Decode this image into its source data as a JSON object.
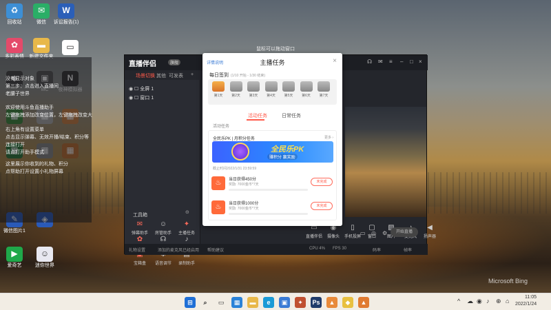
{
  "desktop": {
    "icons": [
      {
        "label": "回收站",
        "color": "#3d8fd6",
        "glyph": "♻"
      },
      {
        "label": "微信",
        "color": "#2aae67",
        "glyph": "✉"
      },
      {
        "label": "诉讼报告(1)",
        "color": "#2b5fb8",
        "glyph": "W"
      },
      {
        "label": "多彩表情",
        "color": "#e44a6a",
        "glyph": "✿"
      },
      {
        "label": "新建文件夹",
        "color": "#e8b84a",
        "glyph": "▬"
      },
      {
        "label": "",
        "color": "#ffffff",
        "glyph": "▭"
      },
      {
        "label": "",
        "color": "#444444",
        "glyph": "◆"
      },
      {
        "label": "MC",
        "color": "#555555",
        "glyph": "▣"
      },
      {
        "label": "夜神模拟器",
        "color": "#333333",
        "glyph": "N"
      },
      {
        "label": "",
        "color": "#3a8a3a",
        "glyph": "▦"
      },
      {
        "label": "",
        "color": "#b0b0b0",
        "glyph": "▦"
      },
      {
        "label": "",
        "color": "#d08040",
        "glyph": "▦"
      },
      {
        "label": "",
        "color": "#2c7a3a",
        "glyph": "▦"
      },
      {
        "label": "",
        "color": "#888888",
        "glyph": "▦"
      },
      {
        "label": "",
        "color": "#c07030",
        "glyph": "▦"
      },
      {
        "label": "微信图片1",
        "color": "#2a5ab8",
        "glyph": "✎"
      },
      {
        "label": "",
        "color": "#2a5ab8",
        "glyph": "◈"
      },
      {
        "label": "爱奇艺",
        "color": "#1fa84a",
        "glyph": "▶"
      },
      {
        "label": "迷你世界",
        "color": "#e8e8f0",
        "glyph": "☺"
      }
    ],
    "notes": [
      "没有显示对象",
      "第三步：点击进入直播间",
      "老腰子世界",
      "欢迎使用斗鱼直播助手",
      "左键拖拽添加改变位置，左键拖拽改变大",
      "右上角有设置菜单",
      "点击显示弹幕、无效开播/结束、积分等",
      "连接打开",
      "请点打开助手模式",
      "这里展示你收到的礼物、积分",
      "点帮助打开设置小礼物屏幕"
    ],
    "watermark_text": "鼠标可以拖动窗口",
    "bing": "Microsoft Bing"
  },
  "app": {
    "title": "直播伴侣",
    "badge": "旗舰",
    "tabs": [
      "场景切换",
      "其他",
      "可发表"
    ],
    "scenes": [
      "全屏 1",
      "窗口 1"
    ],
    "tools_title": "工具箱",
    "tools": [
      {
        "label": "弹幕助手",
        "glyph": "✉",
        "accent": true
      },
      {
        "label": "房管助手",
        "glyph": "☺",
        "accent": false
      },
      {
        "label": "主播任务",
        "glyph": "✦",
        "accent": true
      },
      {
        "label": "福利活动",
        "glyph": "✿",
        "accent": true
      },
      {
        "label": "多人连麦",
        "glyph": "☊",
        "accent": false
      },
      {
        "label": "推荐助手",
        "glyph": "♪",
        "accent": false
      },
      {
        "label": "宝箱盒",
        "glyph": "▣",
        "accent": true
      },
      {
        "label": "语音调节",
        "glyph": "✱",
        "accent": false
      },
      {
        "label": "录制助手",
        "glyph": "▤",
        "accent": false
      }
    ],
    "controls": [
      {
        "label": "直播伴侣",
        "glyph": "▭"
      },
      {
        "label": "摄像头",
        "glyph": "◉"
      },
      {
        "label": "手机投屏",
        "glyph": "▯"
      },
      {
        "label": "窗口",
        "glyph": "▢"
      },
      {
        "label": "图片",
        "glyph": "▨"
      },
      {
        "label": "麦克风",
        "glyph": "♪"
      },
      {
        "label": "扬声器",
        "glyph": "◀"
      }
    ],
    "start_live": "开始直播",
    "status": [
      "礼物设置",
      "添加的麦克风已经启用",
      "帮助建议"
    ],
    "status_right": [
      "CPU 4%",
      "FPS 30",
      "码率",
      "帧率"
    ]
  },
  "modal": {
    "help": "详情说明",
    "title": "主播任务",
    "close": "×",
    "checkin_title": "每日签到",
    "checkin_sub": "(1/10 开始 - 1/30 结束)",
    "days": [
      "第1天",
      "第2天",
      "第3天",
      "第4天",
      "第5天",
      "第6天",
      "第7天"
    ],
    "tabs": [
      "活动任务",
      "日常任务"
    ],
    "section": "活动任务",
    "card_title": "全民乐PK | 月积分任务",
    "card_more": "更多 ›",
    "banner_text": "全民乐PK",
    "banner_sub": "赚积分 赢奖励",
    "deadline": "截止时间2022/1/31 23:59:59",
    "tasks": [
      {
        "name": "当日获得450分",
        "reward": "奖励: 7000金币*7天",
        "button": "未完成"
      },
      {
        "name": "当日获得1000分",
        "reward": "奖励: 7000金币*7天",
        "button": "未完成"
      }
    ]
  },
  "taskbar": {
    "time": "11:05",
    "date": "2022/1/24",
    "icons": [
      {
        "name": "windows-start",
        "color": "#1f6fd6",
        "glyph": "⊞"
      },
      {
        "name": "search",
        "color": "#f2ede4",
        "glyph": "⌕"
      },
      {
        "name": "task-view",
        "color": "#f2ede4",
        "glyph": "▭"
      },
      {
        "name": "widgets",
        "color": "#2a82d8",
        "glyph": "▦"
      },
      {
        "name": "file-explorer",
        "color": "#e8b84a",
        "glyph": "▬"
      },
      {
        "name": "edge",
        "color": "#1a9ad6",
        "glyph": "e"
      },
      {
        "name": "store",
        "color": "#3a7bd5",
        "glyph": "▣"
      },
      {
        "name": "app-game",
        "color": "#c05030",
        "glyph": "✦"
      },
      {
        "name": "photoshop",
        "color": "#1f3b6a",
        "glyph": "Ps"
      },
      {
        "name": "streamer-app",
        "color": "#e88a3a",
        "glyph": "▲"
      },
      {
        "name": "app-color",
        "color": "#e8c040",
        "glyph": "◆"
      },
      {
        "name": "app-orange",
        "color": "#e07a30",
        "glyph": "▲"
      }
    ],
    "tray": [
      "^",
      "☁",
      "◉",
      "♪",
      "⊕",
      "⌂"
    ]
  }
}
